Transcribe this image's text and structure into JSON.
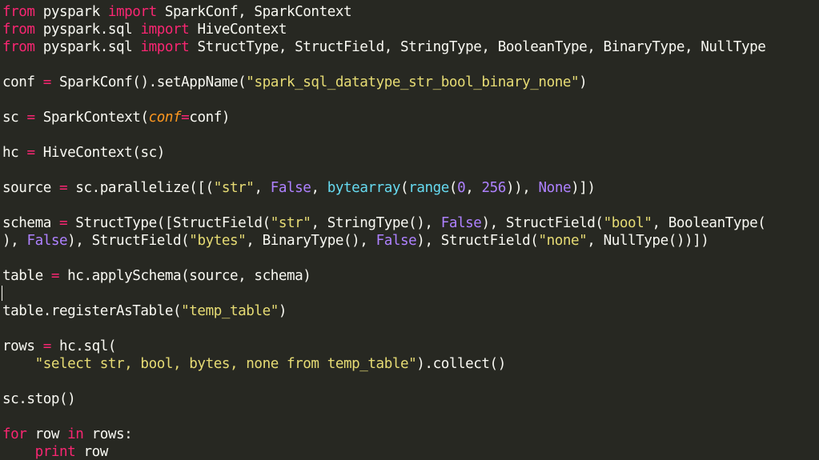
{
  "editor": {
    "theme_colors": {
      "background": "#272822",
      "text": "#f8f8f2",
      "keyword": "#f92672",
      "string": "#e6db74",
      "number_constant": "#ae81ff",
      "builtin": "#66d9ef",
      "parameter": "#fd971f"
    },
    "lines": [
      {
        "line": 1,
        "tokens": [
          {
            "t": "from",
            "c": "kw"
          },
          {
            "t": " pyspark "
          },
          {
            "t": "import",
            "c": "kw"
          },
          {
            "t": " SparkConf, SparkContext"
          }
        ]
      },
      {
        "line": 2,
        "tokens": [
          {
            "t": "from",
            "c": "kw"
          },
          {
            "t": " pyspark.sql "
          },
          {
            "t": "import",
            "c": "kw"
          },
          {
            "t": " HiveContext"
          }
        ]
      },
      {
        "line": 3,
        "tokens": [
          {
            "t": "from",
            "c": "kw"
          },
          {
            "t": " pyspark.sql "
          },
          {
            "t": "import",
            "c": "kw"
          },
          {
            "t": " StructType, StructField, StringType, BooleanType, BinaryType, NullType"
          }
        ]
      },
      {
        "line": 4,
        "tokens": []
      },
      {
        "line": 5,
        "tokens": [
          {
            "t": "conf "
          },
          {
            "t": "=",
            "c": "op"
          },
          {
            "t": " SparkConf().setAppName("
          },
          {
            "t": "\"spark_sql_datatype_str_bool_binary_none\"",
            "c": "str"
          },
          {
            "t": ")"
          }
        ]
      },
      {
        "line": 6,
        "tokens": []
      },
      {
        "line": 7,
        "tokens": [
          {
            "t": "sc "
          },
          {
            "t": "=",
            "c": "op"
          },
          {
            "t": " SparkContext("
          },
          {
            "t": "conf",
            "c": "param"
          },
          {
            "t": "=",
            "c": "op"
          },
          {
            "t": "conf)"
          }
        ]
      },
      {
        "line": 8,
        "tokens": []
      },
      {
        "line": 9,
        "tokens": [
          {
            "t": "hc "
          },
          {
            "t": "=",
            "c": "op"
          },
          {
            "t": " HiveContext(sc)"
          }
        ]
      },
      {
        "line": 10,
        "tokens": []
      },
      {
        "line": 11,
        "tokens": [
          {
            "t": "source "
          },
          {
            "t": "=",
            "c": "op"
          },
          {
            "t": " sc.parallelize([("
          },
          {
            "t": "\"str\"",
            "c": "str"
          },
          {
            "t": ", "
          },
          {
            "t": "False",
            "c": "const"
          },
          {
            "t": ", "
          },
          {
            "t": "bytearray",
            "c": "bi"
          },
          {
            "t": "("
          },
          {
            "t": "range",
            "c": "bi"
          },
          {
            "t": "("
          },
          {
            "t": "0",
            "c": "num"
          },
          {
            "t": ", "
          },
          {
            "t": "256",
            "c": "num"
          },
          {
            "t": ")), "
          },
          {
            "t": "None",
            "c": "const"
          },
          {
            "t": ")])"
          }
        ]
      },
      {
        "line": 12,
        "tokens": []
      },
      {
        "line": 13,
        "tokens": [
          {
            "t": "schema "
          },
          {
            "t": "=",
            "c": "op"
          },
          {
            "t": " StructType([StructField("
          },
          {
            "t": "\"str\"",
            "c": "str"
          },
          {
            "t": ", StringType(), "
          },
          {
            "t": "False",
            "c": "const"
          },
          {
            "t": "), StructField("
          },
          {
            "t": "\"bool\"",
            "c": "str"
          },
          {
            "t": ", BooleanType("
          }
        ]
      },
      {
        "line": 13.5,
        "tokens": [
          {
            "t": "), "
          },
          {
            "t": "False",
            "c": "const"
          },
          {
            "t": "), StructField("
          },
          {
            "t": "\"bytes\"",
            "c": "str"
          },
          {
            "t": ", BinaryType(), "
          },
          {
            "t": "False",
            "c": "const"
          },
          {
            "t": "), StructField("
          },
          {
            "t": "\"none\"",
            "c": "str"
          },
          {
            "t": ", NullType())])"
          }
        ]
      },
      {
        "line": 14,
        "tokens": []
      },
      {
        "line": 15,
        "tokens": [
          {
            "t": "table "
          },
          {
            "t": "=",
            "c": "op"
          },
          {
            "t": " hc.applySchema(source, schema)"
          }
        ]
      },
      {
        "line": 16,
        "tokens": []
      },
      {
        "line": 17,
        "tokens": [
          {
            "t": "table.registerAsTable("
          },
          {
            "t": "\"temp_table\"",
            "c": "str"
          },
          {
            "t": ")"
          }
        ]
      },
      {
        "line": 18,
        "tokens": []
      },
      {
        "line": 19,
        "tokens": [
          {
            "t": "rows "
          },
          {
            "t": "=",
            "c": "op"
          },
          {
            "t": " hc.sql("
          }
        ]
      },
      {
        "line": 20,
        "tokens": [
          {
            "t": "    "
          },
          {
            "t": "\"select str, bool, bytes, none from temp_table\"",
            "c": "str"
          },
          {
            "t": ").collect()"
          }
        ]
      },
      {
        "line": 21,
        "tokens": []
      },
      {
        "line": 22,
        "tokens": [
          {
            "t": "sc.stop()"
          }
        ]
      },
      {
        "line": 23,
        "tokens": []
      },
      {
        "line": 24,
        "tokens": [
          {
            "t": "for",
            "c": "kw"
          },
          {
            "t": " row "
          },
          {
            "t": "in",
            "c": "kw"
          },
          {
            "t": " rows:"
          }
        ]
      },
      {
        "line": 25,
        "tokens": [
          {
            "t": "    "
          },
          {
            "t": "print",
            "c": "kw"
          },
          {
            "t": " row"
          }
        ]
      }
    ]
  }
}
